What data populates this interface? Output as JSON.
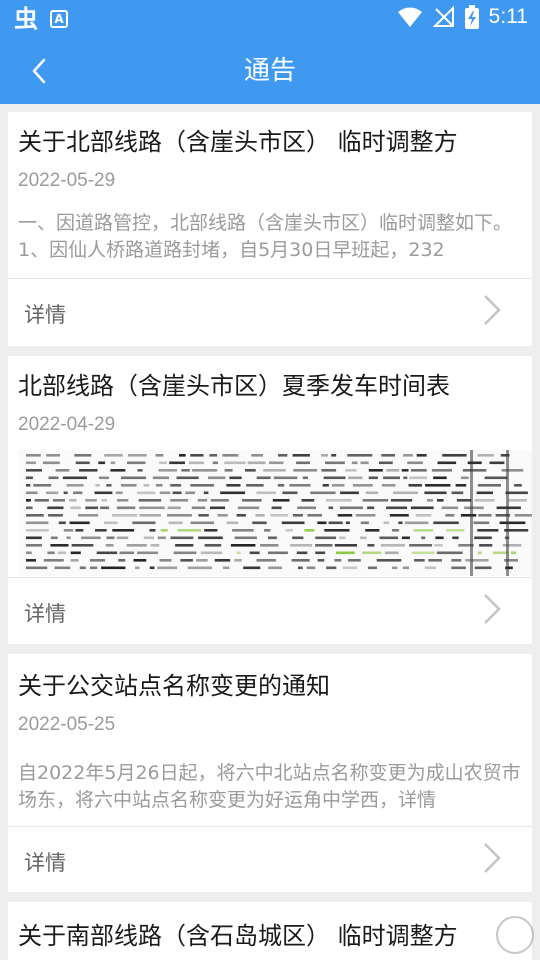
{
  "status_bar": {
    "time": "5:11",
    "icons": [
      "app-glyph-icon",
      "a-notification-icon",
      "wifi-icon",
      "signal-off-icon",
      "battery-charging-icon"
    ]
  },
  "header": {
    "title": "通告",
    "back_icon": "back-arrow-icon"
  },
  "notices": [
    {
      "title": "关于北部线路（含崖头市区） 临时调整方",
      "date": "2022-05-29",
      "summary": "一、因道路管控，北部线路（含崖头市区）临时调整如下。1、因仙人桥路道路封堵，自5月30日早班起，232",
      "detail_label": "详情"
    },
    {
      "title": "北部线路（含崖头市区）夏季发车时间表",
      "date": "2022-04-29",
      "image": "timetable-thumbnail",
      "detail_label": "详情"
    },
    {
      "title": "关于公交站点名称变更的通知",
      "date": "2022-05-25",
      "summary": "自2022年5月26日起，将六中北站点名称变更为成山农贸市场东，将六中站点名称变更为好运角中学西，详情",
      "detail_label": "详情"
    },
    {
      "title": "关于南部线路（含石岛城区） 临时调整方"
    }
  ],
  "colors": {
    "primary": "#3f99f1",
    "background": "#eeeeee",
    "card": "#ffffff",
    "muted_text": "#9b9b9b",
    "title_text": "#1a1a1a"
  }
}
